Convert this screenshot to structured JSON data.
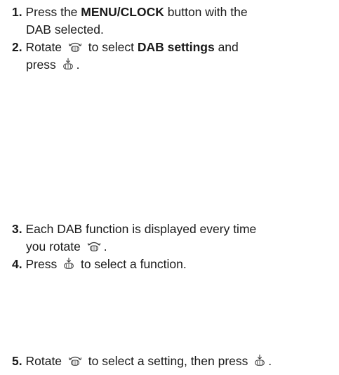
{
  "steps": [
    {
      "num": "1.",
      "line1_pre": "Press the ",
      "line1_kw": "MENU/CLOCK",
      "line1_post": " button with the",
      "line2": "DAB selected."
    },
    {
      "num": "2.",
      "line1_pre": "Rotate ",
      "line1_mid": " to select ",
      "line1_kw": "DAB settings",
      "line1_post": " and",
      "line2_pre": "press ",
      "line2_post": "."
    },
    {
      "num": "3.",
      "line1": "Each DAB function is displayed every time",
      "line2_pre": "you rotate ",
      "line2_post": "."
    },
    {
      "num": "4.",
      "line1_pre": "Press ",
      "line1_post": " to select a function."
    },
    {
      "num": "5.",
      "line1_pre": "Rotate ",
      "line1_mid": " to select a setting, then press ",
      "line1_post": "."
    }
  ],
  "icons": {
    "rotate": "rotate-knob-icon",
    "press": "press-knob-icon"
  }
}
